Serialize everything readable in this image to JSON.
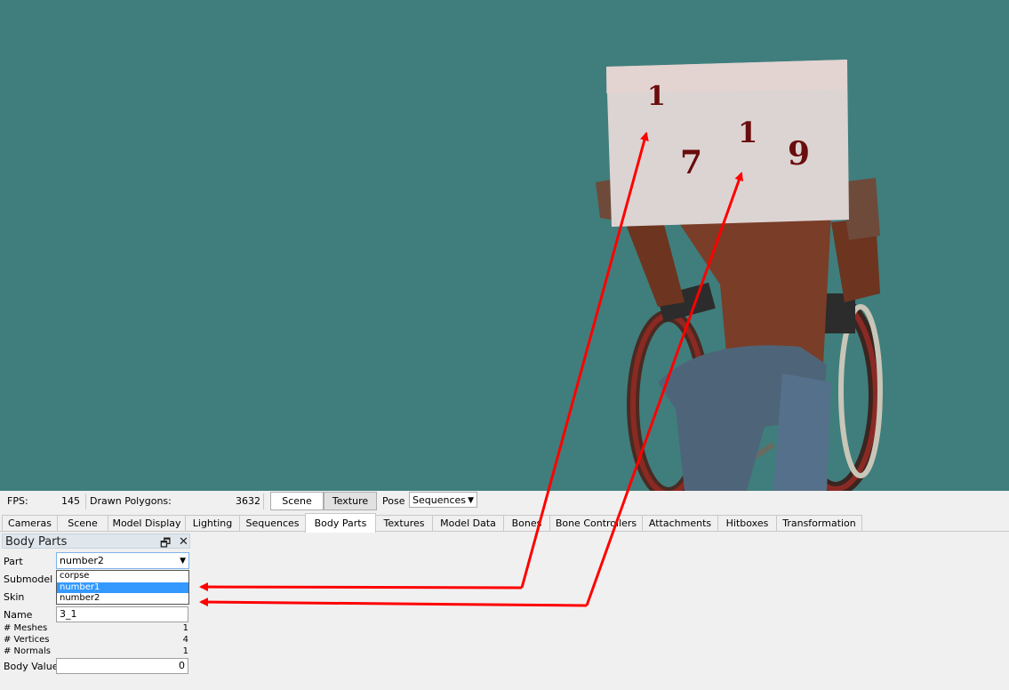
{
  "status": {
    "fps_label": "FPS:",
    "fps_value": "145",
    "polygons_label": "Drawn Polygons:",
    "polygons_value": "3632",
    "scene_button": "Scene",
    "texture_button": "Texture",
    "pose_label": "Pose",
    "pose_value": "Sequences"
  },
  "tabs": [
    "Cameras",
    "Scene",
    "Model Display",
    "Lighting",
    "Sequences",
    "Body Parts",
    "Textures",
    "Model Data",
    "Bones",
    "Bone Controllers",
    "Attachments",
    "Hitboxes",
    "Transformation"
  ],
  "active_tab": "Body Parts",
  "panel": {
    "title": "Body Parts",
    "part_label": "Part",
    "part_value": "number2",
    "submodel_label": "Submodel",
    "skin_label": "Skin",
    "name_label": "Name",
    "name_value": "3_1",
    "meshes_label": "# Meshes",
    "meshes_value": "1",
    "vertices_label": "# Vertices",
    "vertices_value": "4",
    "normals_label": "# Normals",
    "normals_value": "1",
    "body_value_label": "Body Value",
    "body_value": "0",
    "part_options": [
      "corpse",
      "number1",
      "number2"
    ],
    "part_highlighted": "number1"
  },
  "sign": {
    "digits": [
      "1",
      "7",
      "1",
      "9"
    ]
  },
  "colors": {
    "viewport_bg": "#3f7e7c",
    "arrow": "#ff0000",
    "selection": "#3399ff"
  }
}
